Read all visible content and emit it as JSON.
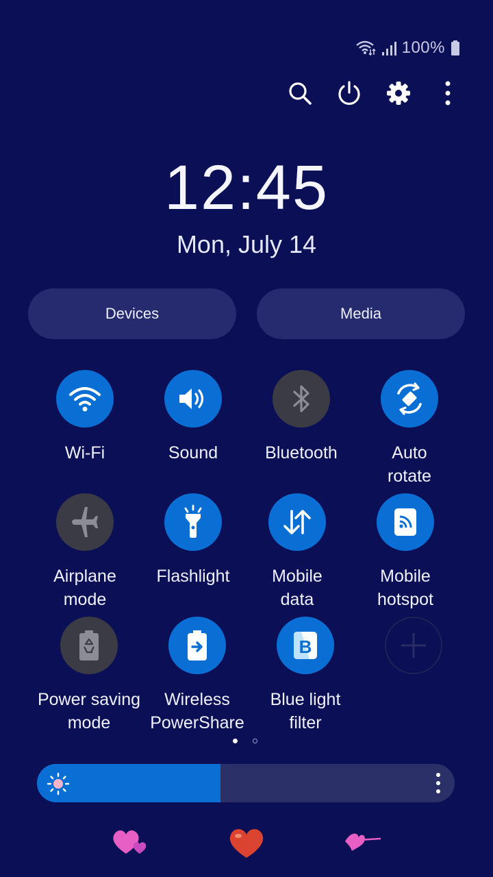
{
  "status_bar": {
    "battery_text": "100%",
    "icons": [
      "wifi-calling-icon",
      "signal-icon",
      "battery-icon"
    ]
  },
  "top_actions": {
    "icons": [
      "search-icon",
      "power-icon",
      "settings-icon",
      "more-options-icon"
    ]
  },
  "clock": {
    "time": "12:45",
    "date": "Mon, July 14"
  },
  "buttons": {
    "devices": "Devices",
    "media": "Media"
  },
  "tiles": [
    {
      "label": "Wi-Fi",
      "icon": "wifi-icon",
      "state": "on"
    },
    {
      "label": "Sound",
      "icon": "volume-icon",
      "state": "on"
    },
    {
      "label": "Bluetooth",
      "icon": "bluetooth-icon",
      "state": "off"
    },
    {
      "label": "Auto\nrotate",
      "icon": "auto-rotate-icon",
      "state": "on"
    },
    {
      "label": "Airplane\nmode",
      "icon": "airplane-icon",
      "state": "off"
    },
    {
      "label": "Flashlight",
      "icon": "flashlight-icon",
      "state": "on"
    },
    {
      "label": "Mobile\ndata",
      "icon": "mobile-data-icon",
      "state": "on"
    },
    {
      "label": "Mobile\nhotspot",
      "icon": "hotspot-icon",
      "state": "on"
    },
    {
      "label": "Power saving\nmode",
      "icon": "power-saving-icon",
      "state": "off"
    },
    {
      "label": "Wireless\nPowerShare",
      "icon": "wireless-powershare-icon",
      "state": "on"
    },
    {
      "label": "Blue light\nfilter",
      "icon": "blue-light-filter-icon",
      "state": "on"
    }
  ],
  "pagination": {
    "page": 1,
    "total_pages": 2
  },
  "brightness": {
    "level": 0.44
  },
  "colors": {
    "background": "#0b0f55",
    "accent": "#0a6fd4",
    "tile_off": "#3a3b44",
    "pill": "#252b6e"
  }
}
